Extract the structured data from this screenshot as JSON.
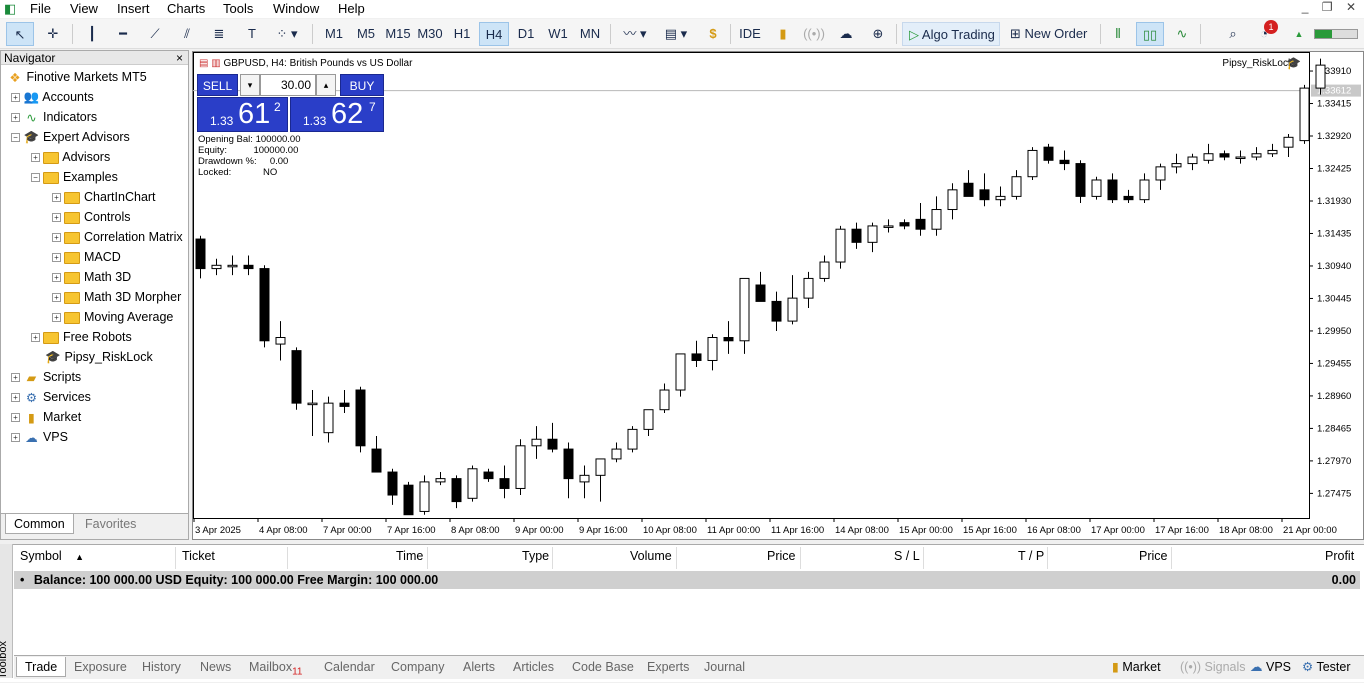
{
  "menu": [
    "File",
    "View",
    "Insert",
    "Charts",
    "Tools",
    "Window",
    "Help"
  ],
  "toolbar": {
    "timeframes": [
      "M1",
      "M5",
      "M15",
      "M30",
      "H1",
      "H4",
      "D1",
      "W1",
      "MN"
    ],
    "selected_timeframe": "H4",
    "ide_label": "IDE",
    "algo_label": "Algo Trading",
    "neworder_label": "New Order",
    "notif_count": "1"
  },
  "navigator": {
    "title": "Navigator",
    "root": "Finotive Markets MT5",
    "items": [
      {
        "label": "Accounts"
      },
      {
        "label": "Indicators"
      },
      {
        "label": "Expert Advisors"
      },
      {
        "label": "Advisors"
      },
      {
        "label": "Examples"
      },
      {
        "label": "ChartInChart"
      },
      {
        "label": "Controls"
      },
      {
        "label": "Correlation Matrix"
      },
      {
        "label": "MACD"
      },
      {
        "label": "Math 3D"
      },
      {
        "label": "Math 3D Morpher"
      },
      {
        "label": "Moving Average"
      },
      {
        "label": "Free Robots"
      },
      {
        "label": "Pipsy_RiskLock"
      },
      {
        "label": "Scripts"
      },
      {
        "label": "Services"
      },
      {
        "label": "Market"
      },
      {
        "label": "VPS"
      }
    ],
    "tabs": [
      "Common",
      "Favorites"
    ]
  },
  "chart": {
    "title": "GBPUSD, H4:  British Pounds vs US Dollar",
    "ea_label": "Pipsy_RiskLock",
    "sell_label": "SELL",
    "buy_label": "BUY",
    "volume": "30.00",
    "sell_prefix": "1.33",
    "sell_big": "61",
    "sell_sup": "2",
    "buy_prefix": "1.33",
    "buy_big": "62",
    "buy_sup": "7",
    "info": [
      {
        "k": "Opening Bal:",
        "v": "100000.00"
      },
      {
        "k": "Equity:",
        "v": "100000.00"
      },
      {
        "k": "Drawdown %:",
        "v": "0.00"
      },
      {
        "k": "Locked:",
        "v": "NO"
      }
    ],
    "current_price_label": "1.33612",
    "price_ticks": [
      "1.33910",
      "1.33415",
      "1.32920",
      "1.32425",
      "1.31930",
      "1.31435",
      "1.30940",
      "1.30445",
      "1.29950",
      "1.29455",
      "1.28960",
      "1.28465",
      "1.27970",
      "1.27475"
    ],
    "time_ticks": [
      "3 Apr 2025",
      "4 Apr 08:00",
      "7 Apr 00:00",
      "7 Apr 16:00",
      "8 Apr 08:00",
      "9 Apr 00:00",
      "9 Apr 16:00",
      "10 Apr 08:00",
      "11 Apr 00:00",
      "11 Apr 16:00",
      "14 Apr 08:00",
      "15 Apr 00:00",
      "15 Apr 16:00",
      "16 Apr 08:00",
      "17 Apr 00:00",
      "17 Apr 16:00",
      "18 Apr 08:00",
      "21 Apr 00:00"
    ]
  },
  "chart_data": {
    "type": "candlestick",
    "symbol": "GBPUSD",
    "timeframe": "H4",
    "ylim": [
      1.271,
      1.342
    ],
    "candles": [
      [
        1.3135,
        1.314,
        1.3075,
        1.309
      ],
      [
        1.309,
        1.3105,
        1.308,
        1.3095
      ],
      [
        1.3095,
        1.311,
        1.308,
        1.3095
      ],
      [
        1.3095,
        1.311,
        1.308,
        1.309
      ],
      [
        1.309,
        1.3095,
        1.297,
        1.298
      ],
      [
        1.2975,
        1.301,
        1.295,
        1.2985
      ],
      [
        1.2965,
        1.297,
        1.2875,
        1.2885
      ],
      [
        1.2885,
        1.2905,
        1.2835,
        1.2885
      ],
      [
        1.284,
        1.2895,
        1.2825,
        1.2885
      ],
      [
        1.2885,
        1.2905,
        1.287,
        1.288
      ],
      [
        1.2905,
        1.291,
        1.281,
        1.282
      ],
      [
        1.2815,
        1.2835,
        1.278,
        1.278
      ],
      [
        1.278,
        1.2785,
        1.273,
        1.2745
      ],
      [
        1.276,
        1.2765,
        1.2715,
        1.2715
      ],
      [
        1.272,
        1.2775,
        1.2715,
        1.2765
      ],
      [
        1.2765,
        1.278,
        1.276,
        1.277
      ],
      [
        1.277,
        1.2775,
        1.2725,
        1.2735
      ],
      [
        1.274,
        1.279,
        1.2735,
        1.2785
      ],
      [
        1.278,
        1.2785,
        1.2765,
        1.277
      ],
      [
        1.277,
        1.279,
        1.274,
        1.2755
      ],
      [
        1.2755,
        1.283,
        1.2745,
        1.282
      ],
      [
        1.282,
        1.285,
        1.28,
        1.283
      ],
      [
        1.283,
        1.2855,
        1.281,
        1.2815
      ],
      [
        1.2815,
        1.2825,
        1.274,
        1.277
      ],
      [
        1.2765,
        1.279,
        1.274,
        1.2775
      ],
      [
        1.2775,
        1.28,
        1.2735,
        1.28
      ],
      [
        1.28,
        1.2825,
        1.2795,
        1.2815
      ],
      [
        1.2815,
        1.285,
        1.281,
        1.2845
      ],
      [
        1.2845,
        1.2875,
        1.2835,
        1.2875
      ],
      [
        1.2875,
        1.2915,
        1.287,
        1.2905
      ],
      [
        1.2905,
        1.2955,
        1.2895,
        1.296
      ],
      [
        1.296,
        1.298,
        1.294,
        1.295
      ],
      [
        1.295,
        1.299,
        1.2935,
        1.2985
      ],
      [
        1.2985,
        1.301,
        1.296,
        1.298
      ],
      [
        1.298,
        1.3015,
        1.296,
        1.3075
      ],
      [
        1.3065,
        1.3085,
        1.3045,
        1.304
      ],
      [
        1.304,
        1.3055,
        1.2995,
        1.301
      ],
      [
        1.301,
        1.308,
        1.3005,
        1.3045
      ],
      [
        1.3045,
        1.3085,
        1.303,
        1.3075
      ],
      [
        1.3075,
        1.311,
        1.307,
        1.31
      ],
      [
        1.31,
        1.3155,
        1.309,
        1.315
      ],
      [
        1.315,
        1.316,
        1.312,
        1.313
      ],
      [
        1.313,
        1.316,
        1.3115,
        1.3155
      ],
      [
        1.3155,
        1.3165,
        1.3145,
        1.3155
      ],
      [
        1.316,
        1.3165,
        1.315,
        1.3155
      ],
      [
        1.3165,
        1.319,
        1.314,
        1.315
      ],
      [
        1.315,
        1.32,
        1.314,
        1.318
      ],
      [
        1.318,
        1.322,
        1.3165,
        1.321
      ],
      [
        1.322,
        1.324,
        1.32,
        1.32
      ],
      [
        1.321,
        1.3235,
        1.3185,
        1.3195
      ],
      [
        1.3195,
        1.3215,
        1.3185,
        1.32
      ],
      [
        1.32,
        1.324,
        1.3195,
        1.323
      ],
      [
        1.323,
        1.3275,
        1.3225,
        1.327
      ],
      [
        1.3275,
        1.328,
        1.325,
        1.3255
      ],
      [
        1.3255,
        1.327,
        1.324,
        1.325
      ],
      [
        1.325,
        1.3255,
        1.319,
        1.32
      ],
      [
        1.32,
        1.323,
        1.3195,
        1.3225
      ],
      [
        1.3225,
        1.3235,
        1.319,
        1.3195
      ],
      [
        1.32,
        1.321,
        1.319,
        1.3195
      ],
      [
        1.3195,
        1.3235,
        1.319,
        1.3225
      ],
      [
        1.3225,
        1.325,
        1.321,
        1.3245
      ],
      [
        1.3245,
        1.3265,
        1.3235,
        1.325
      ],
      [
        1.325,
        1.3265,
        1.324,
        1.326
      ],
      [
        1.3255,
        1.328,
        1.325,
        1.3265
      ],
      [
        1.3265,
        1.327,
        1.3255,
        1.326
      ],
      [
        1.326,
        1.327,
        1.325,
        1.326
      ],
      [
        1.326,
        1.3275,
        1.3255,
        1.3265
      ],
      [
        1.3265,
        1.328,
        1.326,
        1.327
      ],
      [
        1.3275,
        1.3295,
        1.326,
        1.329
      ],
      [
        1.3285,
        1.337,
        1.328,
        1.3365
      ],
      [
        1.3365,
        1.341,
        1.3355,
        1.34
      ]
    ]
  },
  "terminal": {
    "headers": [
      "Symbol",
      "Ticket",
      "Time",
      "Type",
      "Volume",
      "Price",
      "S / L",
      "T / P",
      "Price",
      "Profit"
    ],
    "balance_line": "Balance: 100 000.00 USD  Equity: 100 000.00  Free Margin: 100 000.00",
    "balance_profit": "0.00",
    "tabs": [
      "Trade",
      "Exposure",
      "History",
      "News",
      "Mailbox",
      "Calendar",
      "Company",
      "Alerts",
      "Articles",
      "Code Base",
      "Experts",
      "Journal"
    ],
    "mailbox_count": "11",
    "right_tabs": [
      "Market",
      "Signals",
      "VPS",
      "Tester"
    ],
    "toolbox_label": "Toolbox"
  }
}
